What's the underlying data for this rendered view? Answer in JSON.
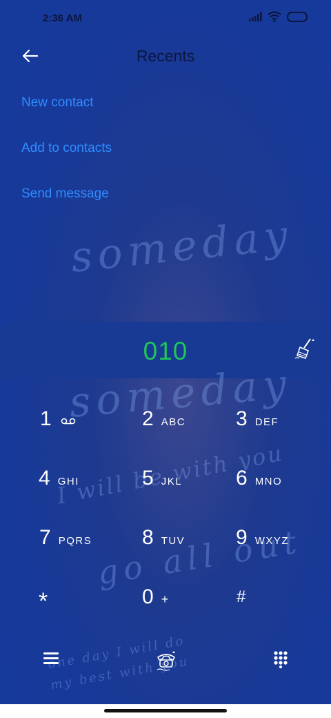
{
  "status": {
    "time": "2:36 AM",
    "icons": [
      "signal-icon",
      "wifi-icon",
      "battery-icon"
    ]
  },
  "header": {
    "title": "Recents",
    "back_icon": "arrow-left-icon"
  },
  "actions": [
    "New contact",
    "Add to contacts",
    "Send message"
  ],
  "dialer": {
    "number": "010",
    "clear_icon": "broom-icon"
  },
  "keys": [
    {
      "num": "1",
      "letters": ""
    },
    {
      "num": "2",
      "letters": "ABC"
    },
    {
      "num": "3",
      "letters": "DEF"
    },
    {
      "num": "4",
      "letters": "GHI"
    },
    {
      "num": "5",
      "letters": "JKL"
    },
    {
      "num": "6",
      "letters": "MNO"
    },
    {
      "num": "7",
      "letters": "PQRS"
    },
    {
      "num": "8",
      "letters": "TUV"
    },
    {
      "num": "9",
      "letters": "WXYZ"
    },
    {
      "num": "*",
      "letters": ""
    },
    {
      "num": "0",
      "letters": "+"
    },
    {
      "num": "#",
      "letters": ""
    }
  ],
  "wallpaper_text": [
    "someday",
    "someday",
    "I will be with you",
    "go all out",
    "one day I will do",
    "my best with you"
  ],
  "bottom_bar": {
    "left_icon": "menu-icon",
    "center_icon": "telephone-icon",
    "right_icon": "keypad-icon"
  },
  "colors": {
    "background": "#163a9c",
    "accent": "#2f8cff",
    "number": "#1fc45a",
    "title": "#0c1640"
  }
}
